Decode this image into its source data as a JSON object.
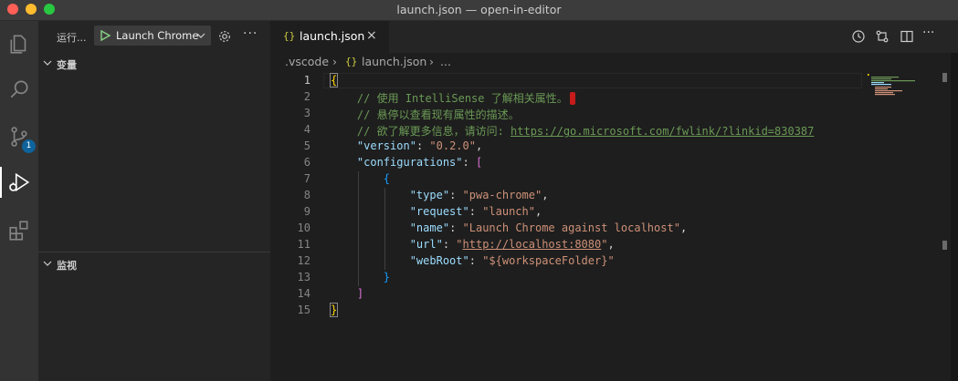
{
  "window": {
    "title": "launch.json — open-in-editor"
  },
  "activity_bar": {
    "items": [
      {
        "name": "explorer",
        "icon": "files-icon"
      },
      {
        "name": "search",
        "icon": "search-icon"
      },
      {
        "name": "source-control",
        "icon": "source-control-icon",
        "badge": "1"
      },
      {
        "name": "run-and-debug",
        "icon": "run-debug-icon",
        "active": true
      },
      {
        "name": "extensions",
        "icon": "extensions-icon"
      }
    ]
  },
  "sidebar": {
    "run_label": "运行...",
    "config_label": "Launch Chrome",
    "sections": {
      "variables": "变量",
      "watch": "监视"
    }
  },
  "tabs": [
    {
      "label": "launch.json",
      "icon": "json-braces-icon",
      "icon_text": "{}",
      "close": "×"
    }
  ],
  "breadcrumb": {
    "folder": ".vscode",
    "file": "launch.json",
    "trail": "...",
    "file_icon_text": "{}"
  },
  "editor": {
    "line_numbers": [
      "1",
      "2",
      "3",
      "4",
      "5",
      "6",
      "7",
      "8",
      "9",
      "10",
      "11",
      "12",
      "13",
      "14",
      "15"
    ],
    "active_line": 1,
    "lines": {
      "l1": "{",
      "l2": "// 使用 IntelliSense 了解相关属性。",
      "l3": "// 悬停以查看现有属性的描述。",
      "l4_prefix": "// 欲了解更多信息，请访问: ",
      "l4_link": "https://go.microsoft.com/fwlink/?linkid=830387",
      "l5_key": "\"version\"",
      "l5_val": "\"0.2.0\"",
      "l6_key": "\"configurations\"",
      "l6_open": "[",
      "l7": "{",
      "l8_key": "\"type\"",
      "l8_val": "\"pwa-chrome\"",
      "l9_key": "\"request\"",
      "l9_val": "\"launch\"",
      "l10_key": "\"name\"",
      "l10_val": "\"Launch Chrome against localhost\"",
      "l11_key": "\"url\"",
      "l11_q1": "\"",
      "l11_link": "http://localhost:8080",
      "l11_q2": "\"",
      "l12_key": "\"webRoot\"",
      "l12_val": "\"${workspaceFolder}\"",
      "l13": "}",
      "l14": "]",
      "l15": "}"
    }
  },
  "colors": {
    "comment": "#6a9955",
    "key": "#9cdcfe",
    "string": "#ce9178",
    "bracket_gold": "#ffd700",
    "bracket_purple": "#da70d6",
    "bracket_blue": "#179fff"
  }
}
